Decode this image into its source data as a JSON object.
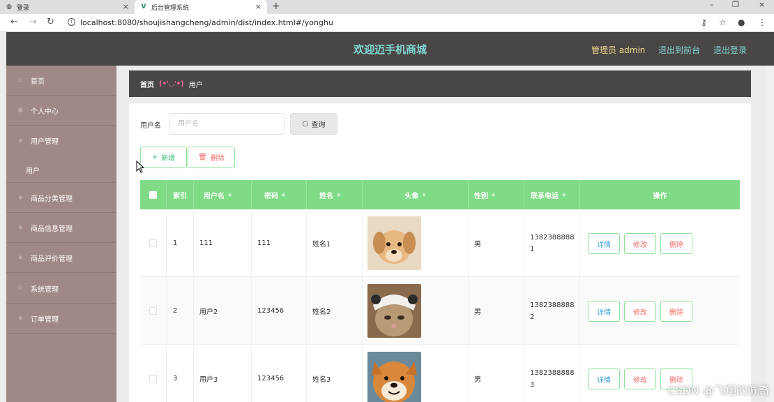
{
  "browser": {
    "tabs": [
      {
        "title": "登录"
      },
      {
        "title": "后台管理系统"
      }
    ],
    "url": "localhost:8080/shoujishangcheng/admin/dist/index.html#/yonghu"
  },
  "header": {
    "title": "欢迎迈手机商城",
    "admin_label": "管理员 admin",
    "frontend_link": "退出到前台",
    "logout_link": "退出登录"
  },
  "sidebar": {
    "items": [
      {
        "label": "首页"
      },
      {
        "label": "个人中心"
      },
      {
        "label": "用户管理"
      },
      {
        "label": "商品分类管理"
      },
      {
        "label": "商品信息管理"
      },
      {
        "label": "商品评价管理"
      },
      {
        "label": "系统管理"
      },
      {
        "label": "订单管理"
      }
    ],
    "submenu_label": "用户"
  },
  "breadcrumb": {
    "home": "首页",
    "separator": "(•'◡'•)",
    "current": "用户"
  },
  "search": {
    "label": "用户名",
    "placeholder": "用户名",
    "button": "查询"
  },
  "actions": {
    "add": "新增",
    "delete": "删除"
  },
  "table": {
    "headers": [
      "索引",
      "用户名",
      "密码",
      "姓名",
      "头像",
      "性别",
      "联系电话",
      "操作"
    ],
    "rows": [
      {
        "index": "1",
        "username": "111",
        "password": "111",
        "name": "姓名1",
        "gender": "男",
        "phone_a": "1382388888",
        "phone_b": "1",
        "avatar": "dog"
      },
      {
        "index": "2",
        "username": "用户2",
        "password": "123456",
        "name": "姓名2",
        "gender": "男",
        "phone_a": "1382388888",
        "phone_b": "2",
        "avatar": "cat"
      },
      {
        "index": "3",
        "username": "用户3",
        "password": "123456",
        "name": "姓名3",
        "gender": "男",
        "phone_a": "1382388888",
        "phone_b": "3",
        "avatar": "shiba"
      }
    ],
    "row_buttons": {
      "detail": "详情",
      "edit": "修改",
      "delete": "删除"
    }
  },
  "watermark": "CSDN @飞翔的佩奇",
  "colors": {
    "header_bg": "#4a4645",
    "sidebar_bg": "#a08886",
    "table_header": "#7fdb86",
    "title_color": "#7fd6d3"
  }
}
